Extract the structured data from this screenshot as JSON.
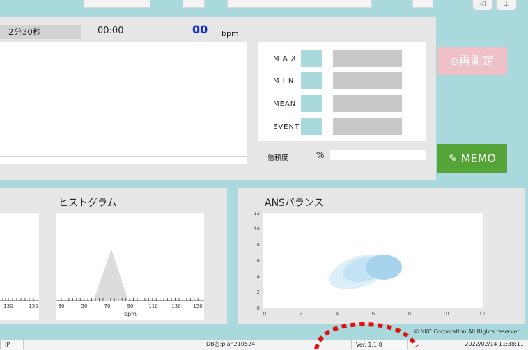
{
  "top_controls": {
    "nav_icons": "◁ ▷  ⊥"
  },
  "header": {
    "duration_label": "2分30秒",
    "elapsed_time": "00:00",
    "heart_rate": "00",
    "heart_rate_unit": "bpm"
  },
  "stats": {
    "items": [
      {
        "label": "M A X"
      },
      {
        "label": "M I N"
      },
      {
        "label": "MEAN"
      },
      {
        "label": "EVENT"
      }
    ],
    "confidence_label": "信頼度",
    "confidence_unit": "%"
  },
  "buttons": {
    "remeasure_label": "再測定",
    "memo_label": "MEMO"
  },
  "histogram": {
    "title": "ヒストグラム",
    "left_ticks": [
      "130",
      "150"
    ],
    "ticks": [
      "30",
      "50",
      "70",
      "90",
      "110",
      "130",
      "150"
    ],
    "xlabel": "bpm",
    "xlim": [
      30,
      150
    ],
    "peak_bpm": 70
  },
  "ans": {
    "title": "ANSバランス",
    "x_ticks": [
      "0",
      "2",
      "4",
      "6",
      "8",
      "10",
      "12"
    ],
    "y_ticks": [
      "0",
      "2",
      "4",
      "6",
      "8",
      "10",
      "12"
    ],
    "xlim": [
      0,
      12
    ],
    "ylim": [
      0,
      12
    ]
  },
  "footer": {
    "copyright": "© YKC Corporation   All Rights reserved.",
    "left_cell": "IP",
    "db_name": "DB名:plan210524",
    "version": "Ver. 1.1.8",
    "datetime": "2022/02/14 11:38:11"
  },
  "colors": {
    "background": "#a9d9dc",
    "heart_rate": "#1428d8",
    "memo": "#54a437",
    "remeasure": "#efc1c6",
    "annotation_circle": "#e01010"
  }
}
